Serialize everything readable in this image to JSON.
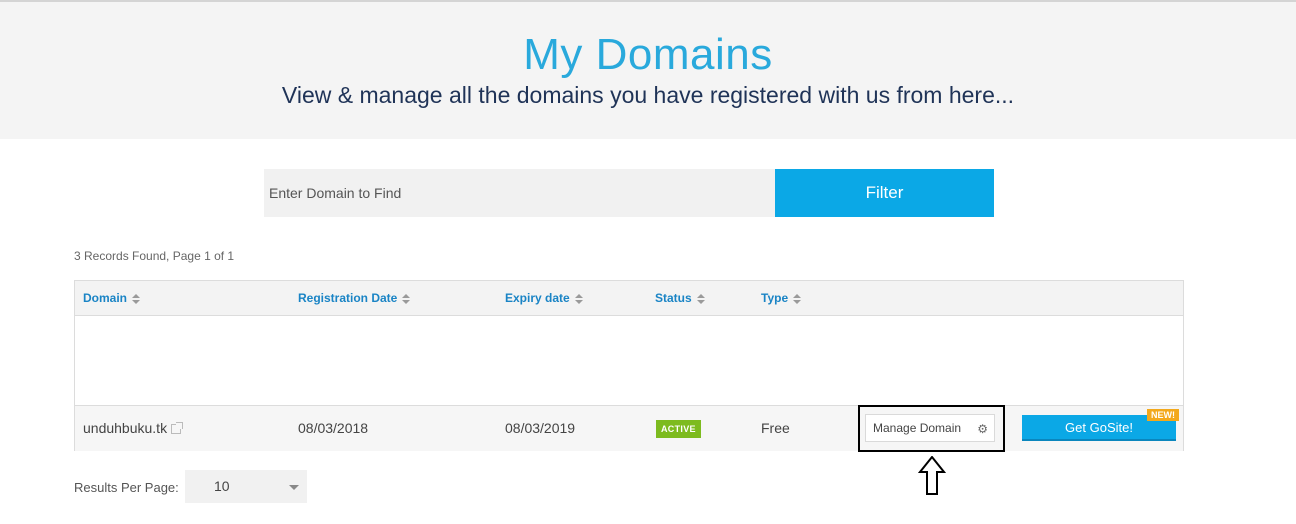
{
  "header": {
    "title": "My Domains",
    "subtitle": "View & manage all the domains you have registered with us from here..."
  },
  "search": {
    "placeholder": "Enter Domain to Find",
    "filter_label": "Filter"
  },
  "records_text": "3 Records Found, Page 1 of 1",
  "table": {
    "columns": [
      "Domain",
      "Registration Date",
      "Expiry date",
      "Status",
      "Type"
    ],
    "rows": [
      {
        "domain": "unduhbuku.tk",
        "registration_date": "08/03/2018",
        "expiry_date": "08/03/2019",
        "status": "ACTIVE",
        "type": "Free",
        "manage_label": "Manage Domain",
        "gosite_label": "Get GoSite!",
        "new_badge": "NEW!"
      }
    ]
  },
  "pagination": {
    "results_per_page_label": "Results Per Page:",
    "results_per_page_value": "10"
  },
  "colors": {
    "accent": "#0ba8e6",
    "title": "#29a9dc",
    "status_active": "#7dbb1f",
    "new_badge": "#f3a91c"
  }
}
